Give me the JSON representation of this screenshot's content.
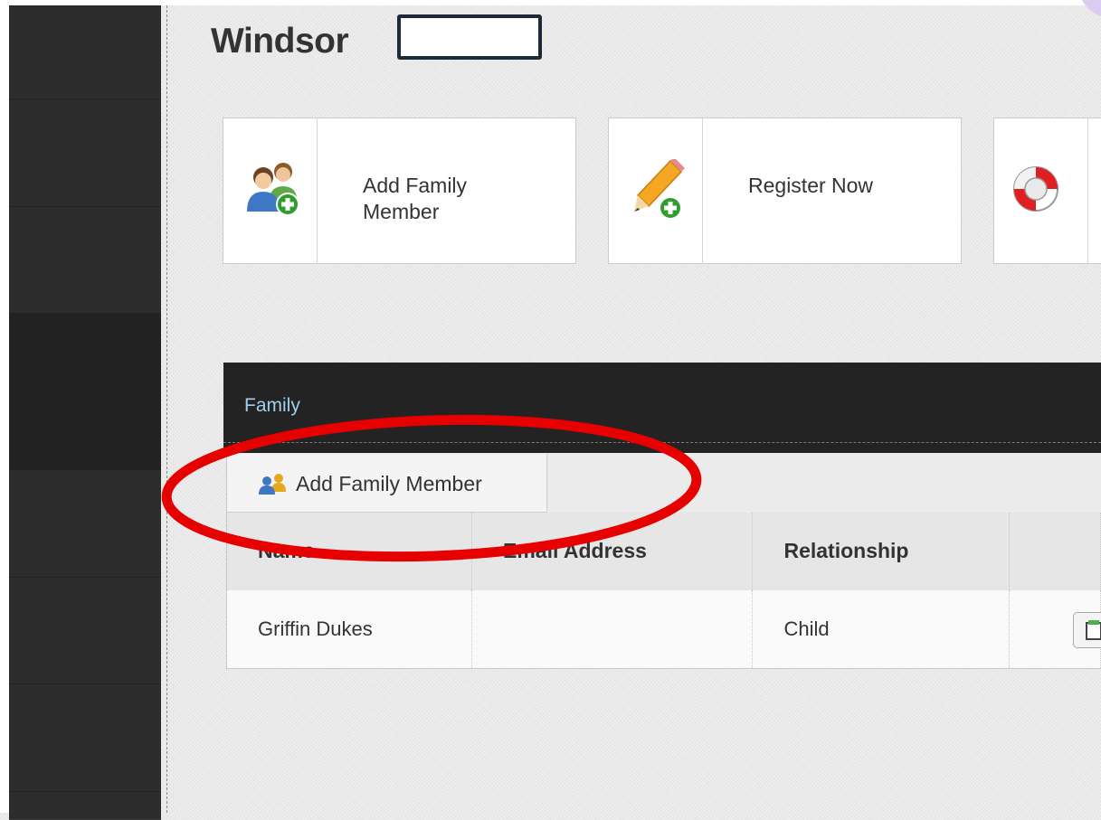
{
  "page": {
    "title": "Windsor"
  },
  "tiles": [
    {
      "line1": "Add Family",
      "line2": "Member",
      "icon": "family-add-icon"
    },
    {
      "line1": "Register Now",
      "icon": "pencil-add-icon"
    },
    {
      "icon": "lifebuoy-icon"
    }
  ],
  "family_panel": {
    "title": "Family",
    "add_button_label": "Add Family Member",
    "columns": [
      "Name",
      "Email Address",
      "Relationship",
      ""
    ],
    "rows": [
      {
        "name": "Griffin Dukes",
        "email": "",
        "relationship": "Child"
      }
    ]
  },
  "colors": {
    "panel_header": "#232323",
    "panel_title": "#9ed0ec",
    "annotation": "#e60000"
  }
}
